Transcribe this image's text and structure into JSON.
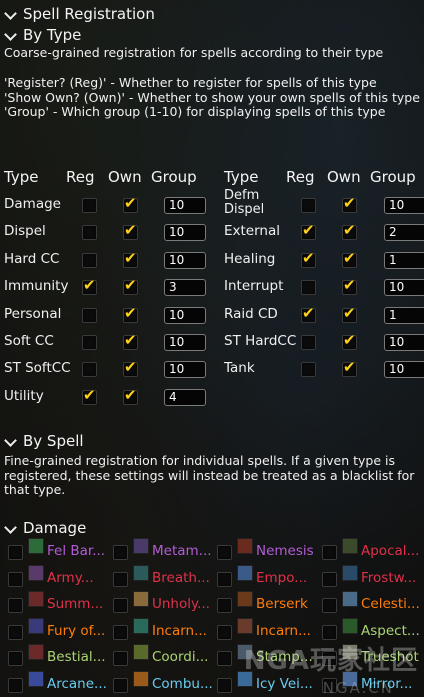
{
  "sections": {
    "spell_registration": "Spell Registration",
    "by_type": "By Type",
    "by_type_desc": "Coarse-grained registration for spells according to their type",
    "legend": [
      "'Register? (Reg)' - Whether to register for spells of this type",
      "'Show Own? (Own)' - Whether to show your own spells of this type",
      "'Group' - Which group (1-10) for displaying spells of this type"
    ],
    "by_spell": "By Spell",
    "by_spell_desc": "Fine-grained registration for individual spells. If a given type is registered, these settings will instead be treated as a blacklist for that type.",
    "damage": "Damage"
  },
  "columns": {
    "type": "Type",
    "reg": "Reg",
    "own": "Own",
    "group": "Group"
  },
  "types_left": [
    {
      "name": "Damage",
      "reg": false,
      "own": true,
      "group": "10"
    },
    {
      "name": "Dispel",
      "reg": false,
      "own": true,
      "group": "10"
    },
    {
      "name": "Hard CC",
      "reg": false,
      "own": true,
      "group": "10"
    },
    {
      "name": "Immunity",
      "reg": true,
      "own": true,
      "group": "3"
    },
    {
      "name": "Personal",
      "reg": false,
      "own": true,
      "group": "10"
    },
    {
      "name": "Soft CC",
      "reg": false,
      "own": true,
      "group": "10"
    },
    {
      "name": "ST SoftCC",
      "reg": false,
      "own": true,
      "group": "10"
    },
    {
      "name": "Utility",
      "reg": true,
      "own": true,
      "group": "4"
    }
  ],
  "types_right": [
    {
      "name": "Defm Dispel",
      "reg": false,
      "own": true,
      "group": "10"
    },
    {
      "name": "External",
      "reg": true,
      "own": true,
      "group": "2"
    },
    {
      "name": "Healing",
      "reg": true,
      "own": true,
      "group": "1"
    },
    {
      "name": "Interrupt",
      "reg": false,
      "own": true,
      "group": "10"
    },
    {
      "name": "Raid CD",
      "reg": true,
      "own": true,
      "group": "1"
    },
    {
      "name": "ST HardCC",
      "reg": false,
      "own": true,
      "group": "10"
    },
    {
      "name": "Tank",
      "reg": false,
      "own": true,
      "group": "10"
    }
  ],
  "spell_rows": [
    [
      {
        "name": "Fel Bar...",
        "color": "#b45cd6",
        "icon": "#2e6b3a"
      },
      {
        "name": "Metam...",
        "color": "#b45cd6",
        "icon": "#4a3a6a"
      },
      {
        "name": "Nemesis",
        "color": "#b45cd6",
        "icon": "#6a2a1e"
      },
      {
        "name": "Apocal...",
        "color": "#e0314a",
        "icon": "#3a4a2a"
      }
    ],
    [
      {
        "name": "Army...",
        "color": "#e0314a",
        "icon": "#5a3a6a"
      },
      {
        "name": "Breath...",
        "color": "#e0314a",
        "icon": "#2a5a5a"
      },
      {
        "name": "Empo...",
        "color": "#e0314a",
        "icon": "#3a5a8a"
      },
      {
        "name": "Frostw...",
        "color": "#e0314a",
        "icon": "#2a4a6a"
      }
    ],
    [
      {
        "name": "Summ...",
        "color": "#e0314a",
        "icon": "#6a2a2a"
      },
      {
        "name": "Unholy...",
        "color": "#e0314a",
        "icon": "#8a6a3a"
      },
      {
        "name": "Berserk",
        "color": "#ff7d0a",
        "icon": "#6a3a1a"
      },
      {
        "name": "Celesti...",
        "color": "#ff7d0a",
        "icon": "#4a6a8a"
      }
    ],
    [
      {
        "name": "Fury of...",
        "color": "#ff7d0a",
        "icon": "#3a3a7a"
      },
      {
        "name": "Incarn...",
        "color": "#ff7d0a",
        "icon": "#2a6a5a"
      },
      {
        "name": "Incarn...",
        "color": "#ff7d0a",
        "icon": "#6a3a2a"
      },
      {
        "name": "Aspect...",
        "color": "#abd473",
        "icon": "#2a5a2a"
      }
    ],
    [
      {
        "name": "Bestial...",
        "color": "#abd473",
        "icon": "#6a2a2a"
      },
      {
        "name": "Coordi...",
        "color": "#abd473",
        "icon": "#5a6a2a"
      },
      {
        "name": "Stamp...",
        "color": "#abd473",
        "icon": "#4a5a6a"
      },
      {
        "name": "Trueshot",
        "color": "#abd473",
        "icon": "#7a7a6a"
      }
    ],
    [
      {
        "name": "Arcane...",
        "color": "#69ccf0",
        "icon": "#3a4a9a"
      },
      {
        "name": "Combu...",
        "color": "#69ccf0",
        "icon": "#9a5a1a"
      },
      {
        "name": "Icy Vei...",
        "color": "#69ccf0",
        "icon": "#3a6a9a"
      },
      {
        "name": "Mirror...",
        "color": "#69ccf0",
        "icon": "#4a6a9a"
      }
    ]
  ],
  "watermark": {
    "main": "NGA玩家社区",
    "sub": "NGA.CN"
  }
}
